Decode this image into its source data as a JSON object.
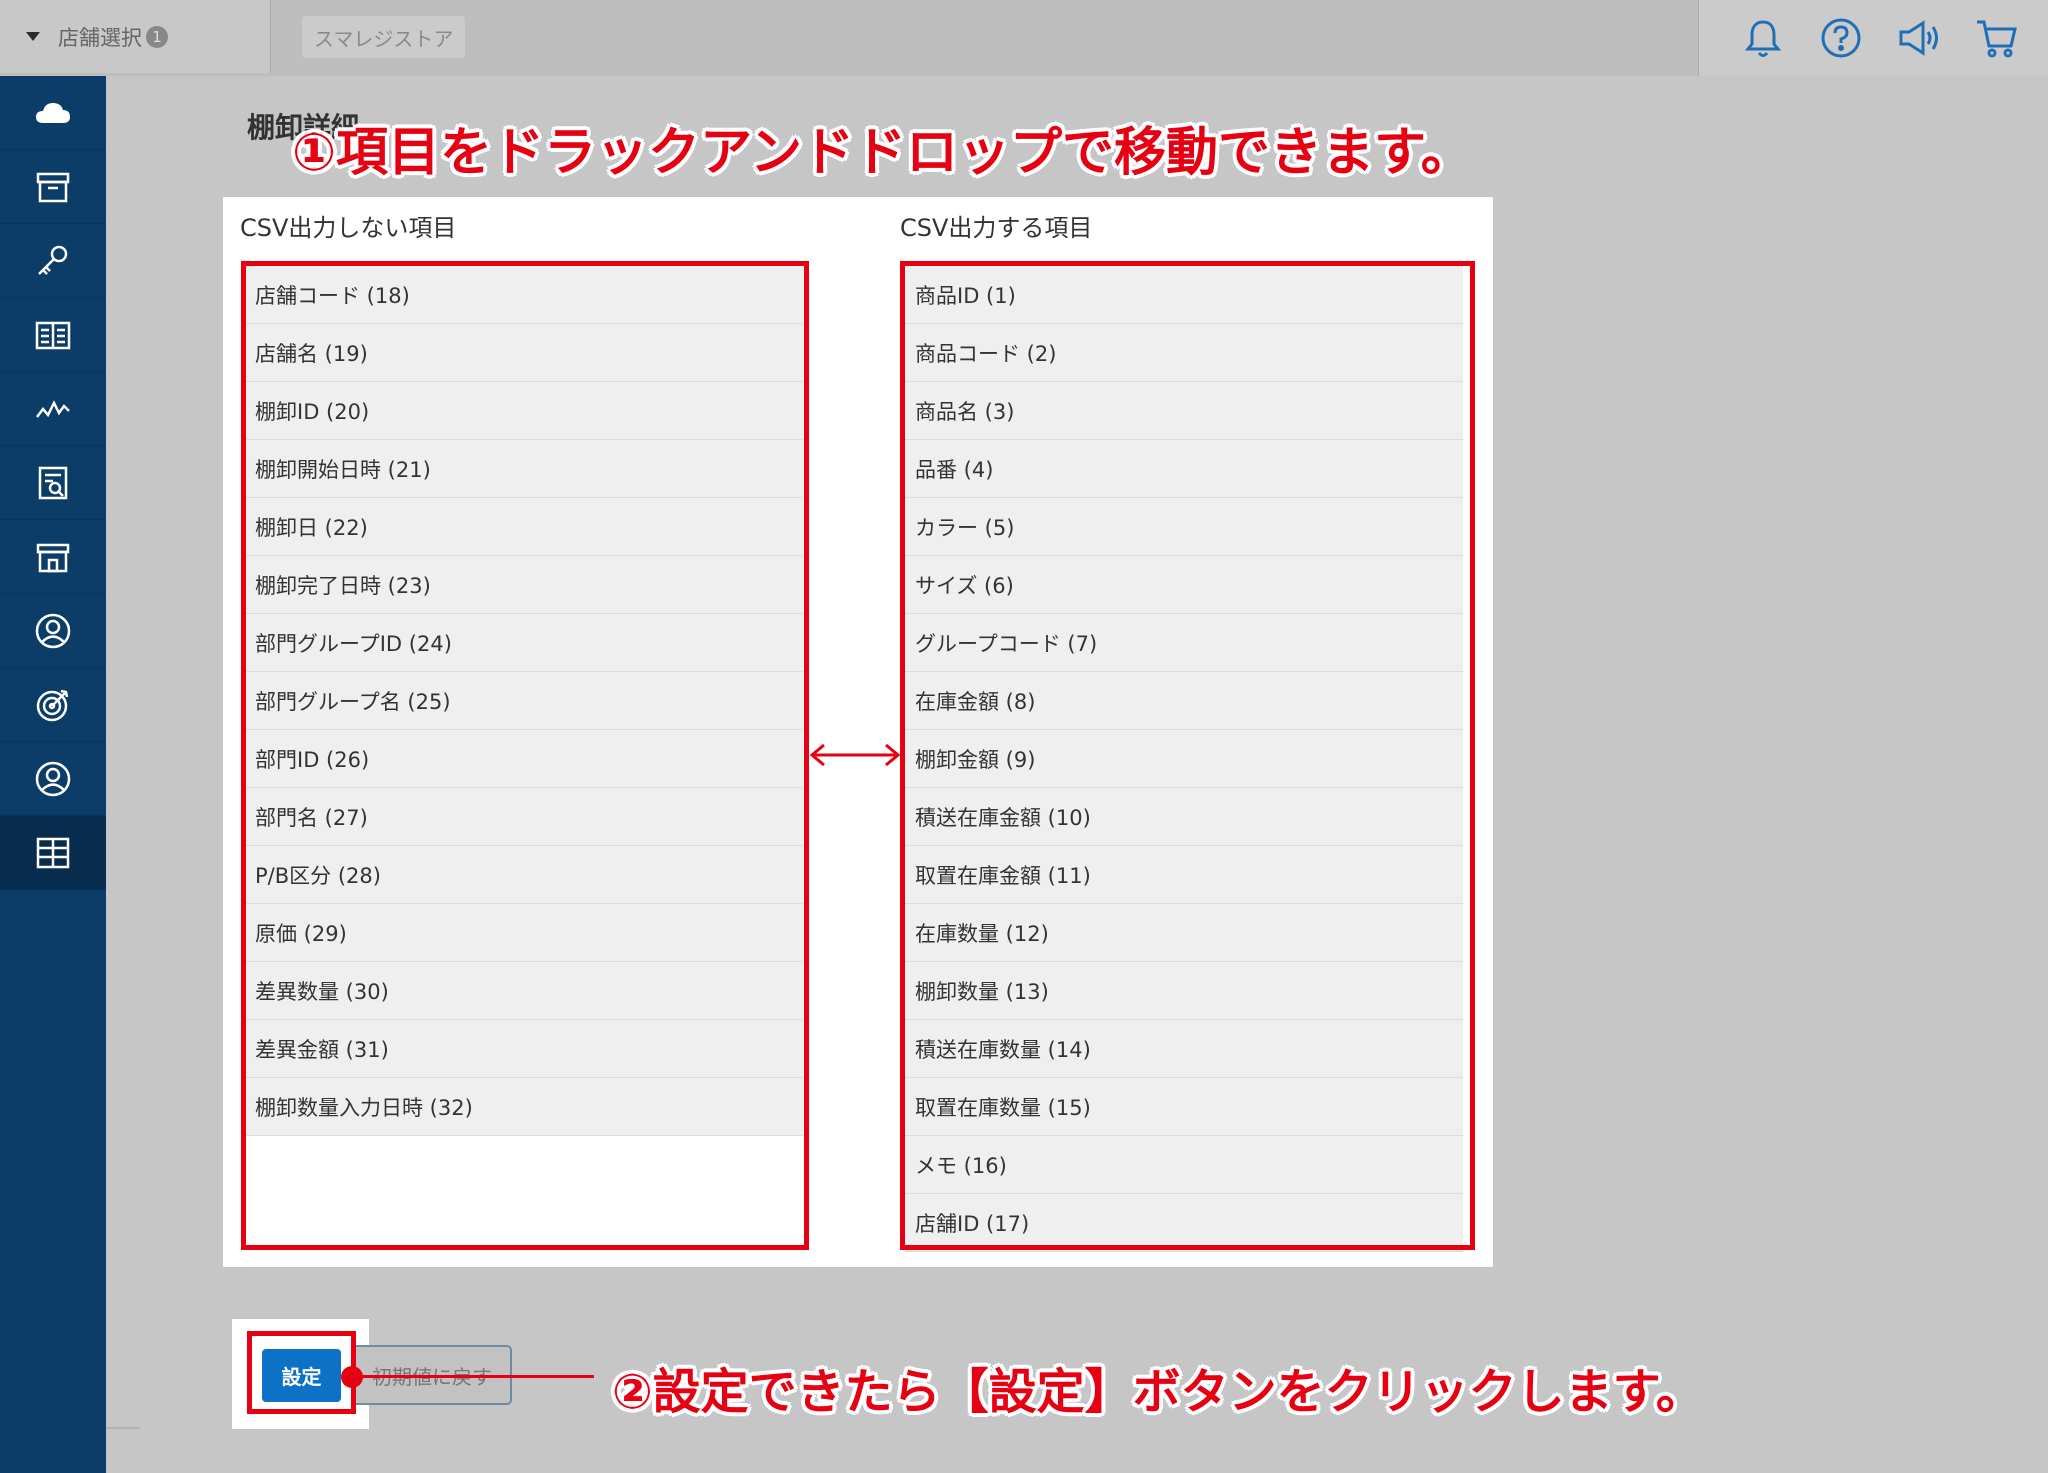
{
  "header": {
    "store_select_label": "店舗選択",
    "store_count": "1",
    "store_tab": "スマレジストア",
    "icons": [
      "bell-icon",
      "help-icon",
      "megaphone-icon",
      "cart-icon"
    ]
  },
  "sidebar": {
    "items": [
      {
        "icon": "cloud-icon"
      },
      {
        "icon": "archive-icon"
      },
      {
        "icon": "key-icon"
      },
      {
        "icon": "book-icon"
      },
      {
        "icon": "chart-line-icon"
      },
      {
        "icon": "report-icon"
      },
      {
        "icon": "store-icon"
      },
      {
        "icon": "customer-icon"
      },
      {
        "icon": "target-icon"
      },
      {
        "icon": "user-icon"
      },
      {
        "icon": "grid-icon",
        "active": true
      }
    ]
  },
  "page": {
    "heading": "棚卸詳細"
  },
  "columns": {
    "left_title": "CSV出力しない項目",
    "right_title": "CSV出力する項目",
    "left_items": [
      "店舗コード (18)",
      "店舗名 (19)",
      "棚卸ID (20)",
      "棚卸開始日時 (21)",
      "棚卸日 (22)",
      "棚卸完了日時 (23)",
      "部門グループID (24)",
      "部門グループ名 (25)",
      "部門ID (26)",
      "部門名 (27)",
      "P/B区分 (28)",
      "原価 (29)",
      "差異数量 (30)",
      "差異金額 (31)",
      "棚卸数量入力日時 (32)"
    ],
    "right_items": [
      "商品ID (1)",
      "商品コード (2)",
      "商品名 (3)",
      "品番 (4)",
      "カラー (5)",
      "サイズ (6)",
      "グループコード (7)",
      "在庫金額 (8)",
      "棚卸金額 (9)",
      "積送在庫金額 (10)",
      "取置在庫金額 (11)",
      "在庫数量 (12)",
      "棚卸数量 (13)",
      "積送在庫数量 (14)",
      "取置在庫数量 (15)",
      "メモ (16)",
      "店舗ID (17)"
    ]
  },
  "buttons": {
    "save": "設定",
    "reset": "初期値に戻す"
  },
  "annotations": {
    "step1": "①項目をドラックアンドドロップで移動できます。",
    "step2": "②設定できたら【設定】ボタンをクリックします。"
  },
  "colors": {
    "accent_red": "#e60012",
    "sidebar": "#0c3d69",
    "primary_button": "#0d72c5",
    "icon_blue": "#1e6fb5"
  }
}
